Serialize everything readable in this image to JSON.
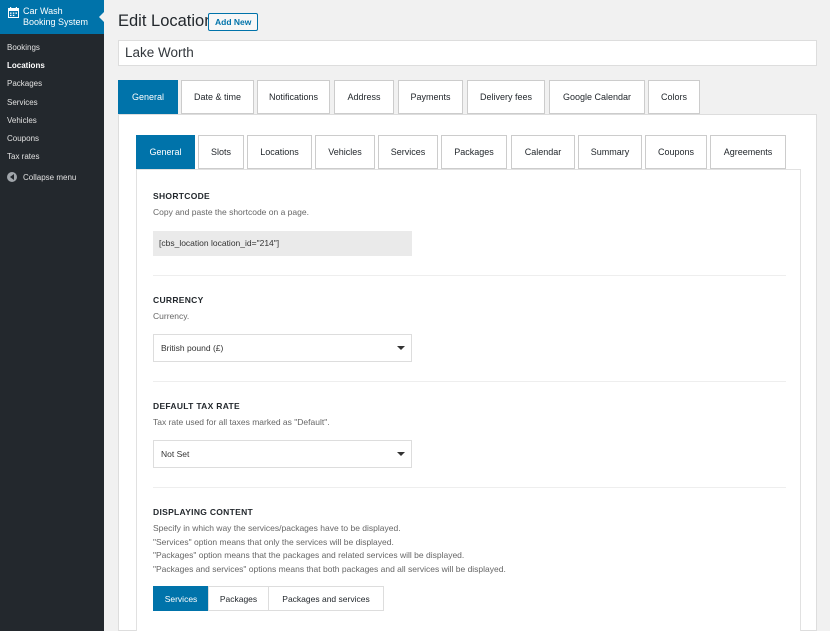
{
  "sidebar": {
    "plugin_title_line1": "Car Wash",
    "plugin_title_line2": "Booking System",
    "items": [
      {
        "label": "Bookings"
      },
      {
        "label": "Locations",
        "active": true
      },
      {
        "label": "Packages"
      },
      {
        "label": "Services"
      },
      {
        "label": "Vehicles"
      },
      {
        "label": "Coupons"
      },
      {
        "label": "Tax rates"
      }
    ],
    "collapse_label": "Collapse menu",
    "icons": {
      "plugin": "calendar-icon",
      "collapse": "collapse-arrow-icon"
    }
  },
  "header": {
    "title": "Edit Location",
    "add_new_label": "Add New",
    "location_name": "Lake Worth"
  },
  "outer_tabs": [
    {
      "label": "General",
      "active": true
    },
    {
      "label": "Date & time"
    },
    {
      "label": "Notifications"
    },
    {
      "label": "Address"
    },
    {
      "label": "Payments"
    },
    {
      "label": "Delivery fees"
    },
    {
      "label": "Google Calendar"
    },
    {
      "label": "Colors"
    }
  ],
  "inner_tabs": [
    {
      "label": "General",
      "active": true
    },
    {
      "label": "Slots"
    },
    {
      "label": "Locations"
    },
    {
      "label": "Vehicles"
    },
    {
      "label": "Services"
    },
    {
      "label": "Packages"
    },
    {
      "label": "Calendar"
    },
    {
      "label": "Summary"
    },
    {
      "label": "Coupons"
    },
    {
      "label": "Agreements"
    }
  ],
  "sections": {
    "shortcode": {
      "title": "SHORTCODE",
      "description": "Copy and paste the shortcode on a page.",
      "value": "[cbs_location location_id=\"214\"]"
    },
    "currency": {
      "title": "CURRENCY",
      "description": "Currency.",
      "selected": "British pound (£)"
    },
    "tax": {
      "title": "DEFAULT TAX RATE",
      "description": "Tax rate used for all taxes marked as \"Default\".",
      "selected": "Not Set"
    },
    "display": {
      "title": "DISPLAYING CONTENT",
      "description_lines": [
        "Specify in which way the services/packages have to be displayed.",
        "\"Services\" option means that only the services will be displayed.",
        "\"Packages\" option means that the packages and related services will be displayed.",
        "\"Packages and services\" options means that both packages and all services will be displayed."
      ],
      "options": [
        {
          "label": "Services",
          "active": true
        },
        {
          "label": "Packages"
        },
        {
          "label": "Packages and services"
        }
      ]
    }
  },
  "colors": {
    "accent": "#0073aa",
    "sidebar": "#23282d",
    "background": "#f1f1f1"
  }
}
